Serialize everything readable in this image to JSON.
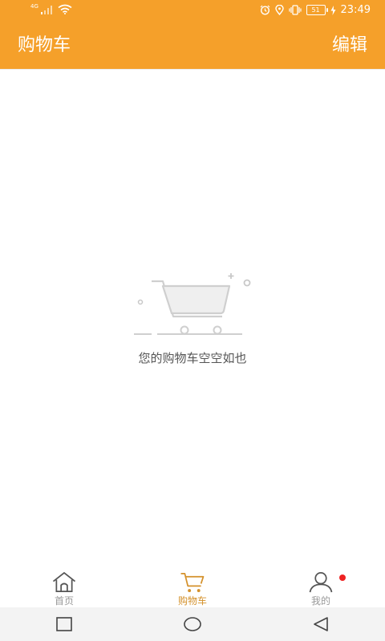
{
  "status_bar": {
    "network_label": "4G",
    "battery": "51",
    "time": "23:49"
  },
  "header": {
    "title": "购物车",
    "edit_label": "编辑"
  },
  "empty_state": {
    "message": "您的购物车空空如也",
    "illustration": "empty-cart-icon"
  },
  "tab_bar": {
    "tabs": [
      {
        "label": "首页",
        "icon": "home-icon",
        "active": false
      },
      {
        "label": "购物车",
        "icon": "cart-icon",
        "active": true
      },
      {
        "label": "我的",
        "icon": "user-icon",
        "active": false,
        "has_badge": true
      }
    ]
  },
  "nav_bar": {
    "buttons": [
      "recent-apps-icon",
      "home-circle-icon",
      "back-triangle-icon"
    ]
  },
  "colors": {
    "brand": "#f5a02a",
    "active_tab": "#d4912b",
    "inactive_tab": "#999999",
    "badge": "#ee2222"
  }
}
